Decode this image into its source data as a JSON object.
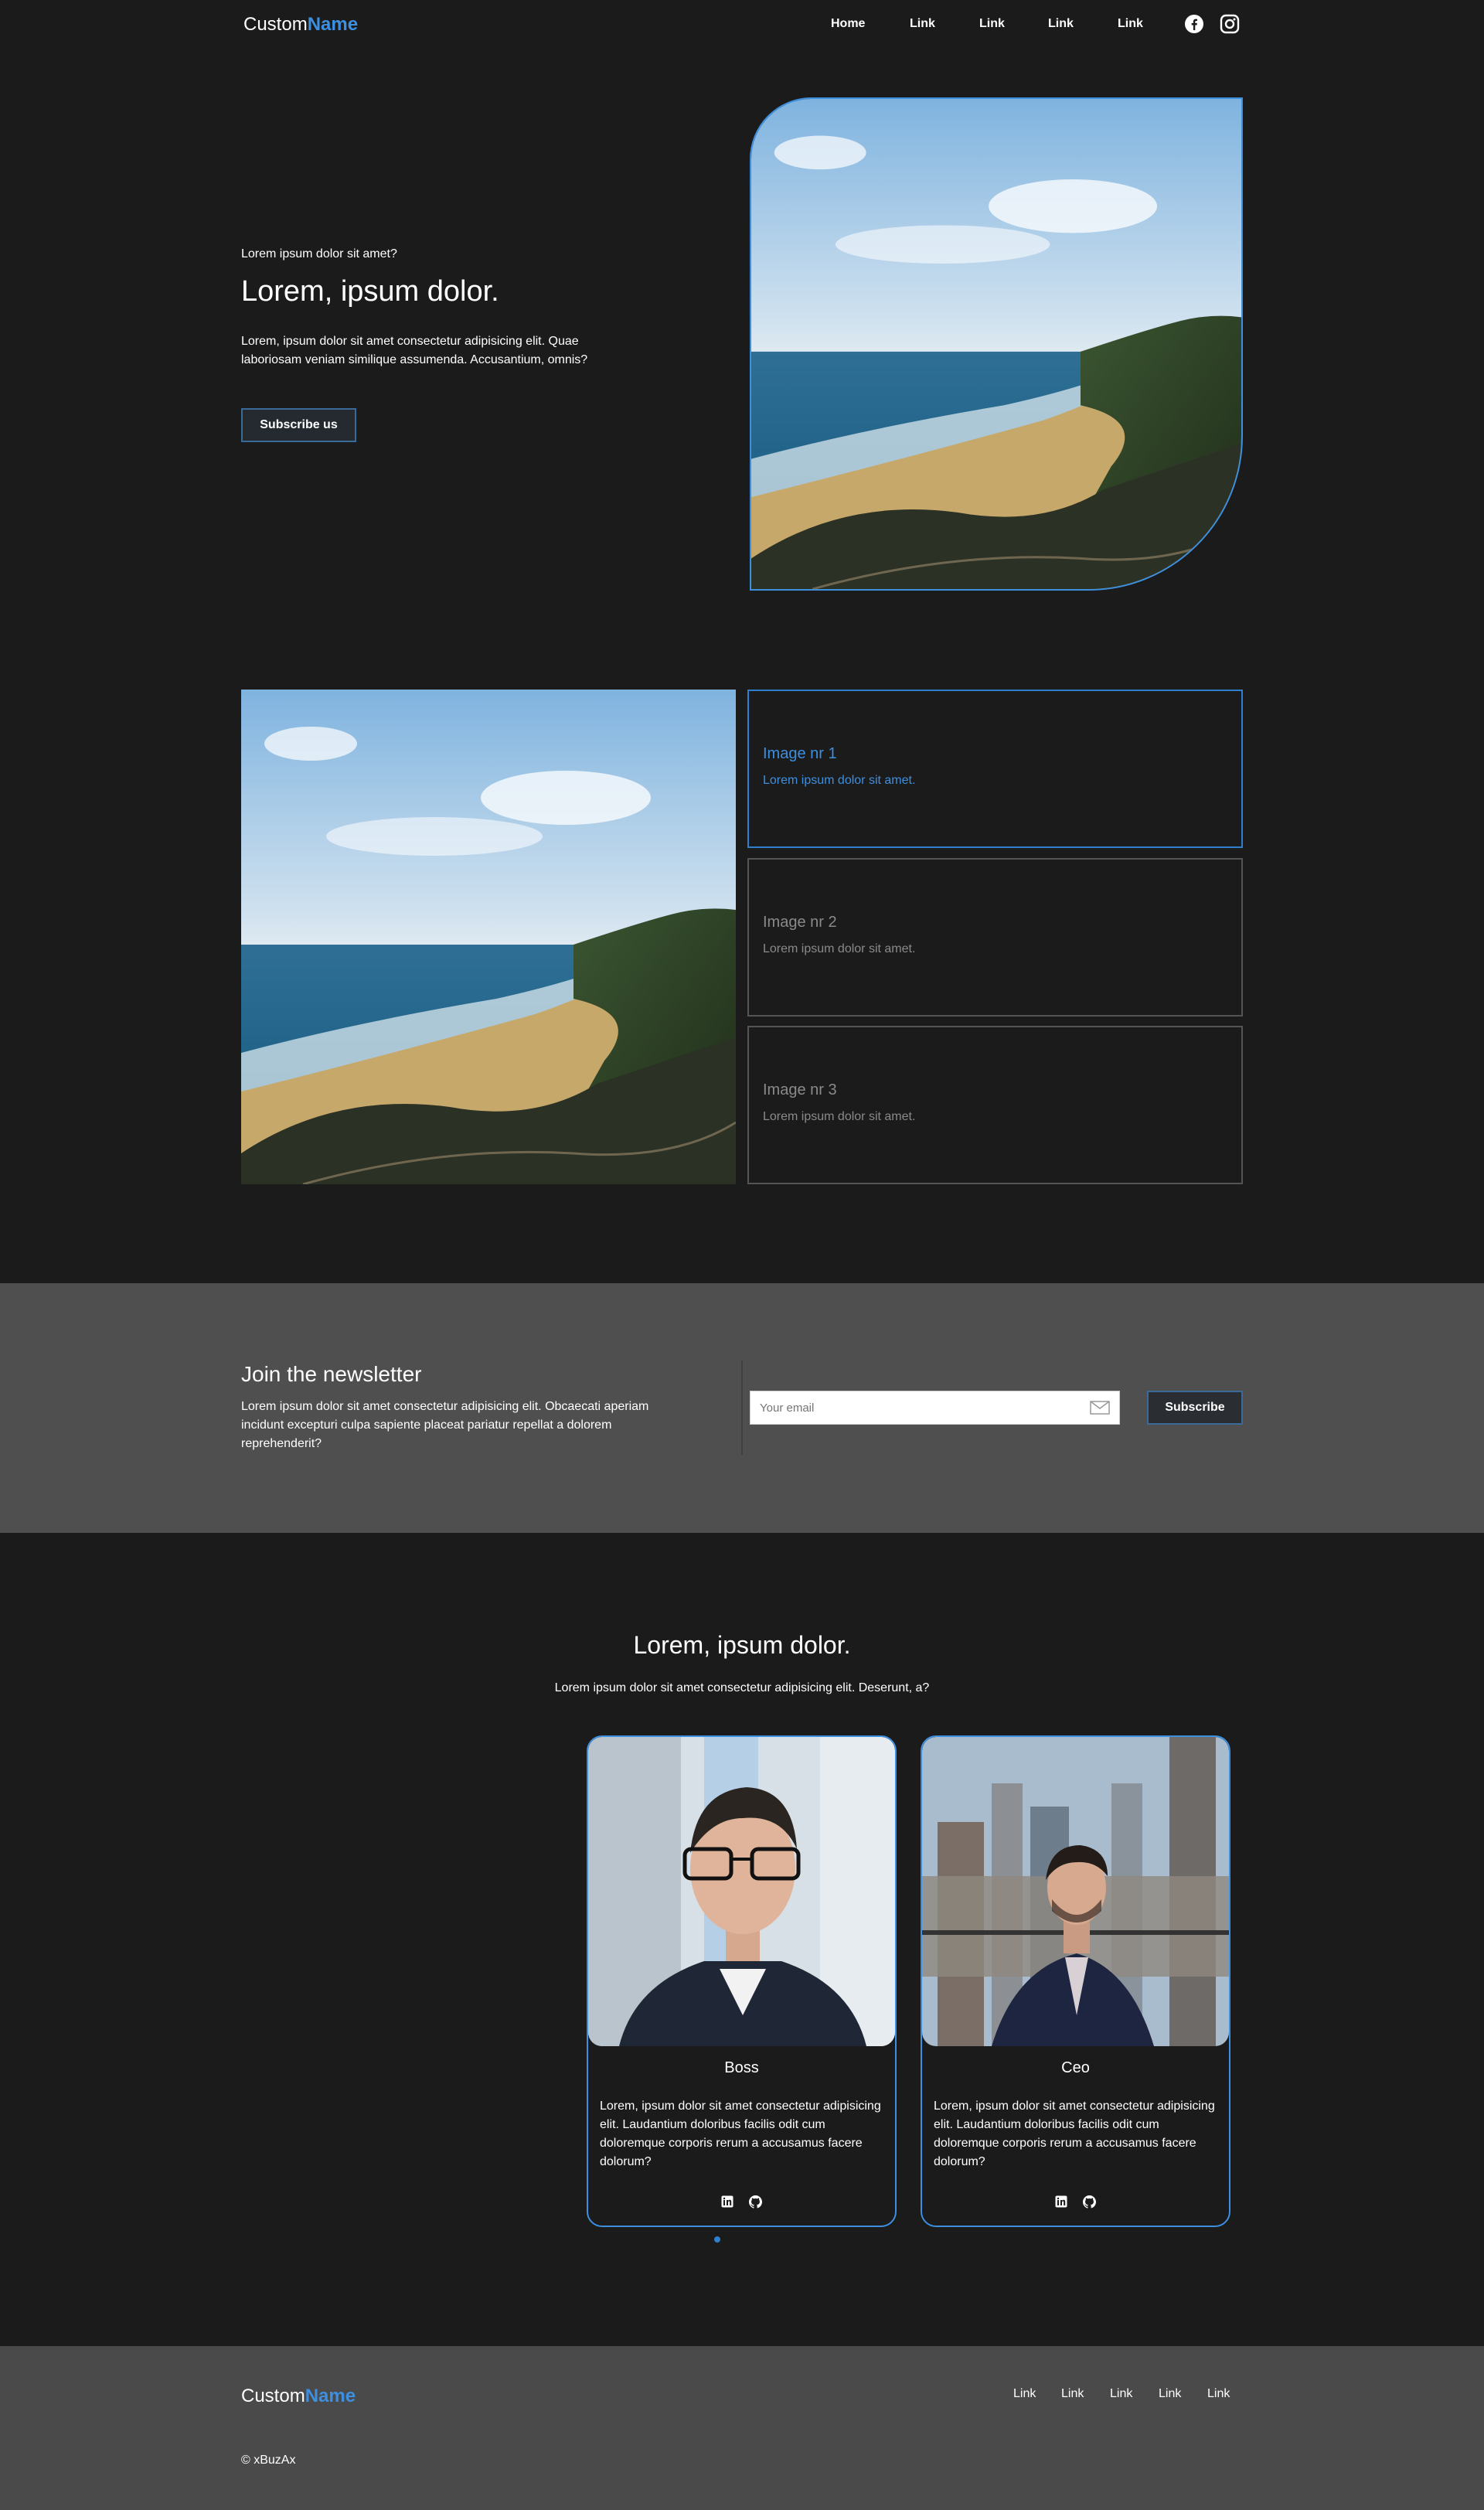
{
  "nav": {
    "logo_main": "Custom",
    "logo_accent": "Name",
    "links": [
      "Home",
      "Link",
      "Link",
      "Link",
      "Link"
    ]
  },
  "hero": {
    "eyebrow": "Lorem ipsum dolor sit amet?",
    "title": "Lorem, ipsum dolor.",
    "text": "Lorem, ipsum dolor sit amet consectetur adipisicing elit. Quae laboriosam veniam similique assumenda. Accusantium, omnis?",
    "button": "Subscribe us"
  },
  "gallery": {
    "items": [
      {
        "title": "Image nr 1",
        "subtitle": "Lorem ipsum dolor sit amet."
      },
      {
        "title": "Image nr 2",
        "subtitle": "Lorem ipsum dolor sit amet."
      },
      {
        "title": "Image nr 3",
        "subtitle": "Lorem ipsum dolor sit amet."
      }
    ]
  },
  "newsletter": {
    "title": "Join the newsletter",
    "text": "Lorem ipsum dolor sit amet consectetur adipisicing elit. Obcaecati aperiam incidunt excepturi culpa sapiente placeat pariatur repellat a dolorem reprehenderit?",
    "email_placeholder": "Your email",
    "button": "Subscribe"
  },
  "team": {
    "title": "Lorem, ipsum dolor.",
    "subtitle": "Lorem ipsum dolor sit amet consectetur adipisicing elit. Deserunt, a?",
    "members": [
      {
        "name": "Boss",
        "bio": "Lorem, ipsum dolor sit amet consectetur adipisicing elit. Laudantium doloribus facilis odit cum doloremque corporis rerum a accusamus facere dolorum?"
      },
      {
        "name": "Ceo",
        "bio": "Lorem, ipsum dolor sit amet consectetur adipisicing elit. Laudantium doloribus facilis odit cum doloremque corporis rerum a accusamus facere dolorum?"
      }
    ]
  },
  "footer": {
    "logo_main": "Custom",
    "logo_accent": "Name",
    "links": [
      "Link",
      "Link",
      "Link",
      "Link",
      "Link"
    ],
    "copyright": "© xBuzAx"
  },
  "colors": {
    "accent": "#3d8fe0",
    "background": "#1b1b1b",
    "newsletter_bg": "#4f4f4f",
    "footer_bg": "#4a4a4a"
  },
  "icons": [
    "facebook-icon",
    "instagram-icon",
    "envelope-icon",
    "linkedin-icon",
    "github-icon"
  ]
}
